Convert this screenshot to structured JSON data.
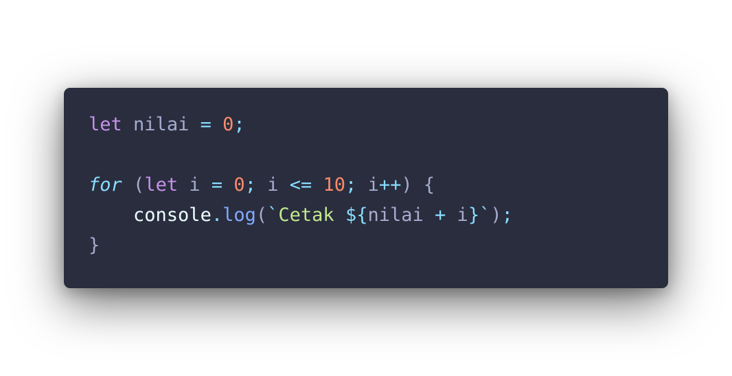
{
  "code": {
    "lines": [
      {
        "tokens": [
          {
            "text": "let",
            "type": "kw"
          },
          {
            "text": " ",
            "type": "ws"
          },
          {
            "text": "nilai",
            "type": "ident"
          },
          {
            "text": " ",
            "type": "ws"
          },
          {
            "text": "=",
            "type": "op"
          },
          {
            "text": " ",
            "type": "ws"
          },
          {
            "text": "0",
            "type": "num"
          },
          {
            "text": ";",
            "type": "punc"
          }
        ]
      },
      {
        "tokens": []
      },
      {
        "tokens": [
          {
            "text": "for",
            "type": "kw-italic"
          },
          {
            "text": " ",
            "type": "ws"
          },
          {
            "text": "(",
            "type": "brace"
          },
          {
            "text": "let",
            "type": "kw"
          },
          {
            "text": " ",
            "type": "ws"
          },
          {
            "text": "i",
            "type": "ident"
          },
          {
            "text": " ",
            "type": "ws"
          },
          {
            "text": "=",
            "type": "op"
          },
          {
            "text": " ",
            "type": "ws"
          },
          {
            "text": "0",
            "type": "num"
          },
          {
            "text": ";",
            "type": "punc"
          },
          {
            "text": " ",
            "type": "ws"
          },
          {
            "text": "i",
            "type": "ident"
          },
          {
            "text": " ",
            "type": "ws"
          },
          {
            "text": "<=",
            "type": "op"
          },
          {
            "text": " ",
            "type": "ws"
          },
          {
            "text": "10",
            "type": "num"
          },
          {
            "text": ";",
            "type": "punc"
          },
          {
            "text": " ",
            "type": "ws"
          },
          {
            "text": "i",
            "type": "ident"
          },
          {
            "text": "++",
            "type": "op"
          },
          {
            "text": ")",
            "type": "brace"
          },
          {
            "text": " ",
            "type": "ws"
          },
          {
            "text": "{",
            "type": "brace"
          }
        ]
      },
      {
        "tokens": [
          {
            "text": "    ",
            "type": "ws"
          },
          {
            "text": "console",
            "type": "obj"
          },
          {
            "text": ".",
            "type": "punc"
          },
          {
            "text": "log",
            "type": "fn"
          },
          {
            "text": "(",
            "type": "brace"
          },
          {
            "text": "`",
            "type": "tpl"
          },
          {
            "text": "Cetak ",
            "type": "str"
          },
          {
            "text": "${",
            "type": "tpl"
          },
          {
            "text": "nilai",
            "type": "ident"
          },
          {
            "text": " ",
            "type": "ws"
          },
          {
            "text": "+",
            "type": "op"
          },
          {
            "text": " ",
            "type": "ws"
          },
          {
            "text": "i",
            "type": "ident"
          },
          {
            "text": "}",
            "type": "tpl"
          },
          {
            "text": "`",
            "type": "tpl"
          },
          {
            "text": ")",
            "type": "brace"
          },
          {
            "text": ";",
            "type": "punc"
          }
        ]
      },
      {
        "tokens": [
          {
            "text": "}",
            "type": "brace"
          }
        ]
      }
    ]
  },
  "theme": {
    "window_bg": "#292d3e",
    "keyword": "#c792ea",
    "keyword_italic": "#89ddff",
    "number": "#f78c6c",
    "string": "#c3e88d",
    "function": "#82aaff",
    "text": "#a6accd"
  }
}
